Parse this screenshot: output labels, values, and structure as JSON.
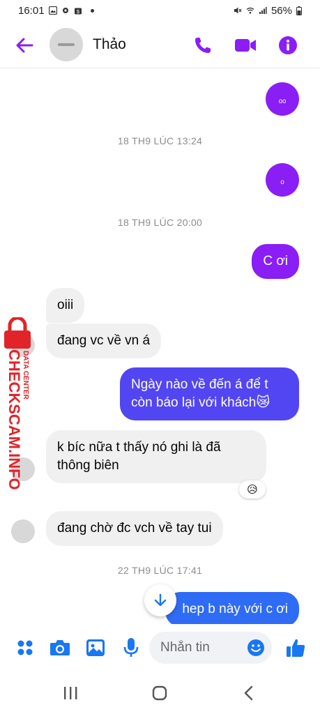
{
  "status_bar": {
    "time": "16:01",
    "battery": "56%",
    "icons": [
      "photo-icon",
      "settings-icon",
      "store-icon",
      "mute-icon",
      "wifi-icon",
      "signal-icon",
      "battery-icon"
    ]
  },
  "header": {
    "contact_name": "Thảo",
    "actions": [
      "phone-icon",
      "video-camera-icon",
      "info-icon"
    ]
  },
  "messages": {
    "m1": {
      "side": "out",
      "text": "ₒₒ"
    },
    "ts1": "18 TH9 LÚC 13:24",
    "m2": {
      "side": "out",
      "text": "ₒ"
    },
    "ts2": "18 TH9 LÚC 20:00",
    "m3": {
      "side": "out",
      "text": "C ơi"
    },
    "m4": {
      "side": "in",
      "text": "oiii"
    },
    "m5": {
      "side": "in",
      "text": "đang vc về vn á"
    },
    "m6": {
      "side": "out",
      "text": "Ngày nào về đến á để t còn báo lại với khách😿"
    },
    "m7": {
      "side": "in",
      "text": "k bíc nữa t thấy nó ghi là đã thông biên",
      "reaction": "😥"
    },
    "m8": {
      "side": "in",
      "text": "đang chờ đc vch về tay tui"
    },
    "ts3": "22 TH9 LÚC 17:41",
    "m9": {
      "side": "out",
      "text": "hep b này với c ơi"
    }
  },
  "watermark": {
    "main": "CHECKSCAM.INFO",
    "sub": "DATA CENTER"
  },
  "composer": {
    "placeholder": "Nhắn tin",
    "icons": [
      "apps-icon",
      "camera-icon",
      "image-icon",
      "microphone-icon",
      "emoji-icon",
      "like-icon"
    ]
  },
  "colors": {
    "accent": "#8a1ef5",
    "bubble_gradient_top": "#8a1ef5",
    "bubble_gradient_mid": "#6b3ff0",
    "bubble_gradient_bottom": "#2f6cf5",
    "composer_icon": "#1877f2",
    "incoming_bubble": "#f0f0f0",
    "watermark": "#e0242a"
  }
}
